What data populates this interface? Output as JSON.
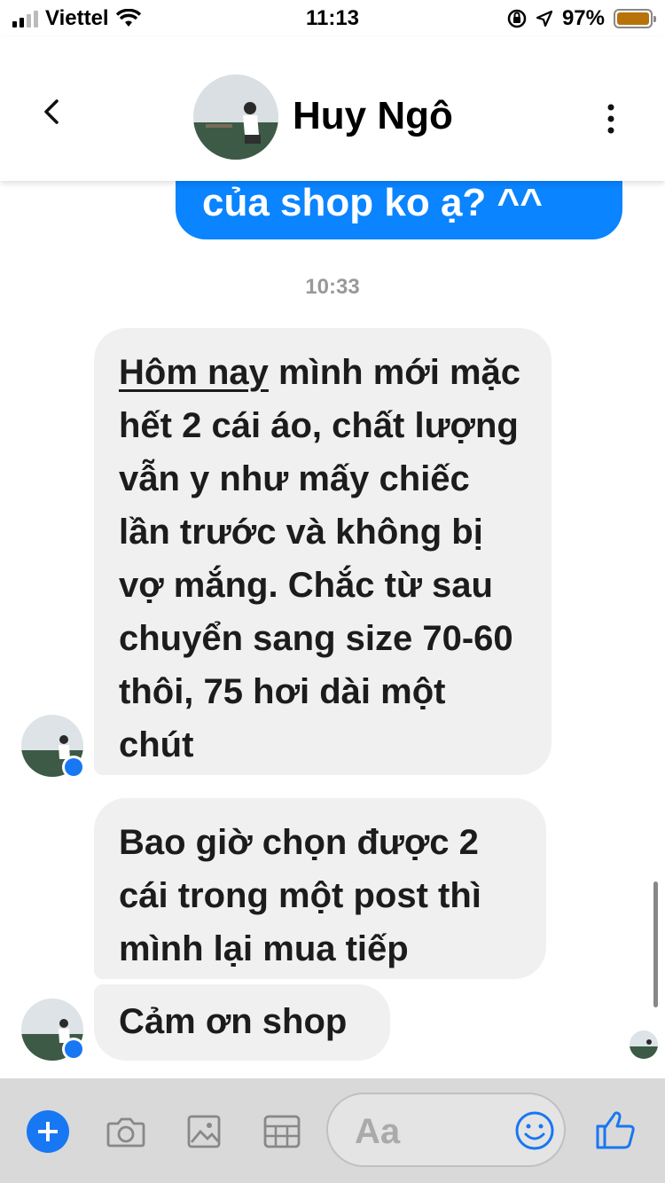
{
  "status_bar": {
    "carrier": "Viettel",
    "time": "11:13",
    "battery": "97%"
  },
  "header": {
    "contact_name": "Huy Ngô"
  },
  "chat": {
    "outgoing_partial": "của shop ko ạ? ^^",
    "timestamp": "10:33",
    "msg1_underlined": "Hôm nay",
    "msg1_rest": " mình mới mặc hết 2 cái áo, chất lượng vẫn y như mấy chiếc lần trước và không bị vợ mắng. Chắc từ sau chuyển sang size 70-60 thôi, 75 hơi dài một chút",
    "msg2": "Bao giờ chọn được 2 cái trong một post thì mình lại mua tiếp",
    "msg3": "Cảm ơn shop"
  },
  "composer": {
    "placeholder": "Aa"
  },
  "colors": {
    "accent": "#0a84ff",
    "messenger_blue": "#1877f2",
    "bubble_gray": "#f0f0f0"
  }
}
